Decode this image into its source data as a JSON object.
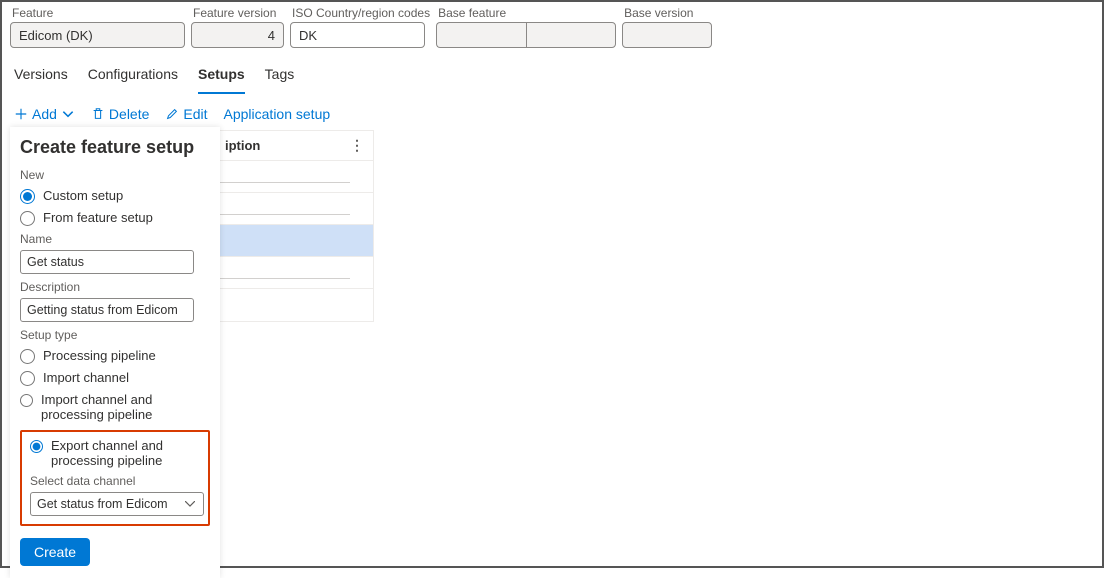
{
  "top": {
    "feature": {
      "label": "Feature",
      "value": "Edicom (DK)"
    },
    "featureVersion": {
      "label": "Feature version",
      "value": "4"
    },
    "iso": {
      "label": "ISO Country/region codes",
      "value": "DK"
    },
    "baseFeature": {
      "label": "Base feature",
      "value": ""
    },
    "baseVersion": {
      "label": "Base version",
      "value": ""
    }
  },
  "tabs": {
    "versions": "Versions",
    "configurations": "Configurations",
    "setups": "Setups",
    "tags": "Tags"
  },
  "toolbar": {
    "add": "Add",
    "delete": "Delete",
    "edit": "Edit",
    "appSetup": "Application setup"
  },
  "grid": {
    "colDescription": "iption"
  },
  "popover": {
    "title": "Create feature setup",
    "newLabel": "New",
    "customSetup": "Custom setup",
    "fromFeatureSetup": "From feature setup",
    "nameLabel": "Name",
    "nameValue": "Get status",
    "descLabel": "Description",
    "descValue": "Getting status from Edicom",
    "setupTypeLabel": "Setup type",
    "processingPipeline": "Processing pipeline",
    "importChannel": "Import channel",
    "importPipeline": "Import channel and processing pipeline",
    "exportPipeline": "Export channel and processing pipeline",
    "selectDataChannelLabel": "Select data channel",
    "dataChannelValue": "Get status from Edicom",
    "createBtn": "Create"
  }
}
